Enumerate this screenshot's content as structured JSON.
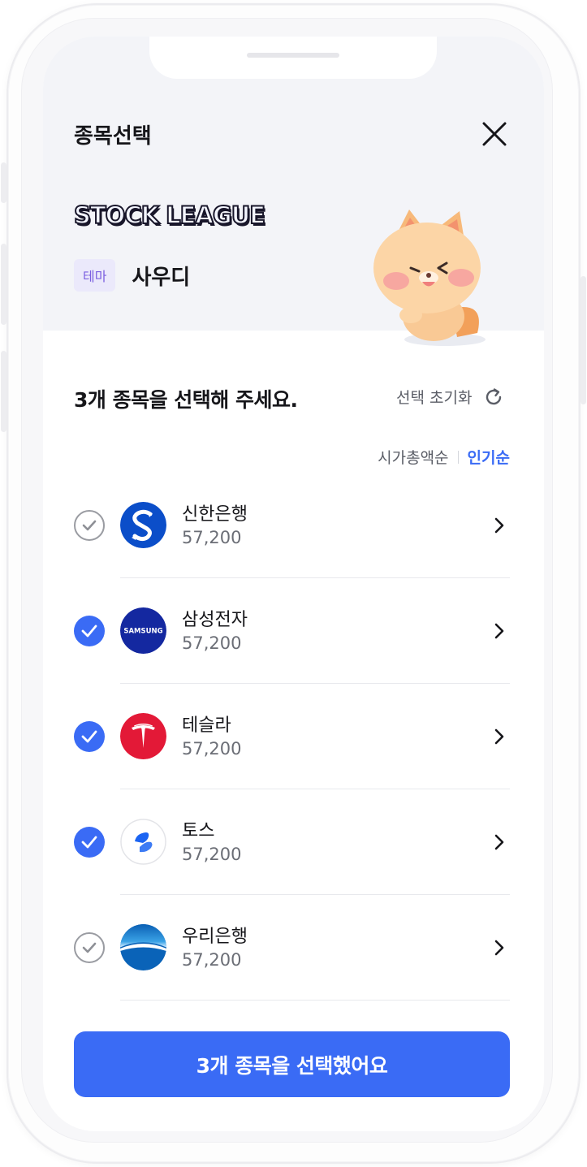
{
  "header": {
    "title": "종목선택",
    "close_icon": "close-icon"
  },
  "hero": {
    "brand": "STOCK LEAGUE",
    "theme_badge": "테마",
    "theme_name": "사우디",
    "mascot": "cat-mascot"
  },
  "selection": {
    "instruction": "3개 종목을 선택해 주세요.",
    "reset_label": "선택 초기화",
    "reset_icon": "refresh-icon"
  },
  "sort": {
    "options": [
      "시가총액순",
      "인기순"
    ],
    "active": "인기순"
  },
  "stocks": [
    {
      "name": "신한은행",
      "price": "57,200",
      "selected": false,
      "logo": "shinhan-logo"
    },
    {
      "name": "삼성전자",
      "price": "57,200",
      "selected": true,
      "logo": "samsung-logo",
      "logo_text": "SAMSUNG"
    },
    {
      "name": "테슬라",
      "price": "57,200",
      "selected": true,
      "logo": "tesla-logo"
    },
    {
      "name": "토스",
      "price": "57,200",
      "selected": true,
      "logo": "toss-logo"
    },
    {
      "name": "우리은행",
      "price": "57,200",
      "selected": false,
      "logo": "woori-logo"
    }
  ],
  "cta": {
    "label": "3개 종목을 선택했어요"
  },
  "colors": {
    "accent": "#3a6bf5",
    "hero_bg": "#f3f4f8",
    "badge_bg": "#ebe9fb",
    "badge_text": "#7b5fe0",
    "samsung_blue": "#1428a0",
    "tesla_red": "#e31937"
  }
}
